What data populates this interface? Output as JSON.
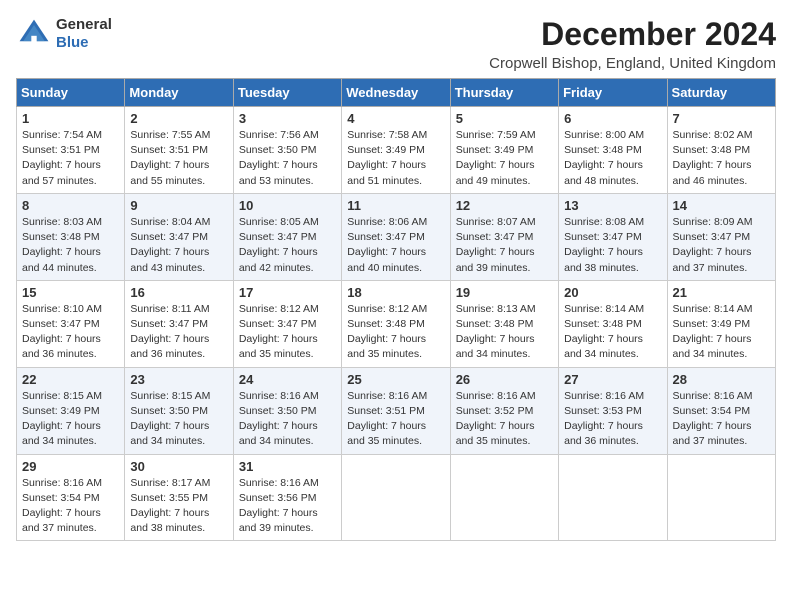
{
  "header": {
    "logo_line1": "General",
    "logo_line2": "Blue",
    "title": "December 2024",
    "subtitle": "Cropwell Bishop, England, United Kingdom"
  },
  "weekdays": [
    "Sunday",
    "Monday",
    "Tuesday",
    "Wednesday",
    "Thursday",
    "Friday",
    "Saturday"
  ],
  "weeks": [
    [
      {
        "day": 1,
        "sunrise": "7:54 AM",
        "sunset": "3:51 PM",
        "daylight": "7 hours and 57 minutes."
      },
      {
        "day": 2,
        "sunrise": "7:55 AM",
        "sunset": "3:51 PM",
        "daylight": "7 hours and 55 minutes."
      },
      {
        "day": 3,
        "sunrise": "7:56 AM",
        "sunset": "3:50 PM",
        "daylight": "7 hours and 53 minutes."
      },
      {
        "day": 4,
        "sunrise": "7:58 AM",
        "sunset": "3:49 PM",
        "daylight": "7 hours and 51 minutes."
      },
      {
        "day": 5,
        "sunrise": "7:59 AM",
        "sunset": "3:49 PM",
        "daylight": "7 hours and 49 minutes."
      },
      {
        "day": 6,
        "sunrise": "8:00 AM",
        "sunset": "3:48 PM",
        "daylight": "7 hours and 48 minutes."
      },
      {
        "day": 7,
        "sunrise": "8:02 AM",
        "sunset": "3:48 PM",
        "daylight": "7 hours and 46 minutes."
      }
    ],
    [
      {
        "day": 8,
        "sunrise": "8:03 AM",
        "sunset": "3:48 PM",
        "daylight": "7 hours and 44 minutes."
      },
      {
        "day": 9,
        "sunrise": "8:04 AM",
        "sunset": "3:47 PM",
        "daylight": "7 hours and 43 minutes."
      },
      {
        "day": 10,
        "sunrise": "8:05 AM",
        "sunset": "3:47 PM",
        "daylight": "7 hours and 42 minutes."
      },
      {
        "day": 11,
        "sunrise": "8:06 AM",
        "sunset": "3:47 PM",
        "daylight": "7 hours and 40 minutes."
      },
      {
        "day": 12,
        "sunrise": "8:07 AM",
        "sunset": "3:47 PM",
        "daylight": "7 hours and 39 minutes."
      },
      {
        "day": 13,
        "sunrise": "8:08 AM",
        "sunset": "3:47 PM",
        "daylight": "7 hours and 38 minutes."
      },
      {
        "day": 14,
        "sunrise": "8:09 AM",
        "sunset": "3:47 PM",
        "daylight": "7 hours and 37 minutes."
      }
    ],
    [
      {
        "day": 15,
        "sunrise": "8:10 AM",
        "sunset": "3:47 PM",
        "daylight": "7 hours and 36 minutes."
      },
      {
        "day": 16,
        "sunrise": "8:11 AM",
        "sunset": "3:47 PM",
        "daylight": "7 hours and 36 minutes."
      },
      {
        "day": 17,
        "sunrise": "8:12 AM",
        "sunset": "3:47 PM",
        "daylight": "7 hours and 35 minutes."
      },
      {
        "day": 18,
        "sunrise": "8:12 AM",
        "sunset": "3:48 PM",
        "daylight": "7 hours and 35 minutes."
      },
      {
        "day": 19,
        "sunrise": "8:13 AM",
        "sunset": "3:48 PM",
        "daylight": "7 hours and 34 minutes."
      },
      {
        "day": 20,
        "sunrise": "8:14 AM",
        "sunset": "3:48 PM",
        "daylight": "7 hours and 34 minutes."
      },
      {
        "day": 21,
        "sunrise": "8:14 AM",
        "sunset": "3:49 PM",
        "daylight": "7 hours and 34 minutes."
      }
    ],
    [
      {
        "day": 22,
        "sunrise": "8:15 AM",
        "sunset": "3:49 PM",
        "daylight": "7 hours and 34 minutes."
      },
      {
        "day": 23,
        "sunrise": "8:15 AM",
        "sunset": "3:50 PM",
        "daylight": "7 hours and 34 minutes."
      },
      {
        "day": 24,
        "sunrise": "8:16 AM",
        "sunset": "3:50 PM",
        "daylight": "7 hours and 34 minutes."
      },
      {
        "day": 25,
        "sunrise": "8:16 AM",
        "sunset": "3:51 PM",
        "daylight": "7 hours and 35 minutes."
      },
      {
        "day": 26,
        "sunrise": "8:16 AM",
        "sunset": "3:52 PM",
        "daylight": "7 hours and 35 minutes."
      },
      {
        "day": 27,
        "sunrise": "8:16 AM",
        "sunset": "3:53 PM",
        "daylight": "7 hours and 36 minutes."
      },
      {
        "day": 28,
        "sunrise": "8:16 AM",
        "sunset": "3:54 PM",
        "daylight": "7 hours and 37 minutes."
      }
    ],
    [
      {
        "day": 29,
        "sunrise": "8:16 AM",
        "sunset": "3:54 PM",
        "daylight": "7 hours and 37 minutes."
      },
      {
        "day": 30,
        "sunrise": "8:17 AM",
        "sunset": "3:55 PM",
        "daylight": "7 hours and 38 minutes."
      },
      {
        "day": 31,
        "sunrise": "8:16 AM",
        "sunset": "3:56 PM",
        "daylight": "7 hours and 39 minutes."
      },
      null,
      null,
      null,
      null
    ]
  ],
  "labels": {
    "sunrise": "Sunrise:",
    "sunset": "Sunset:",
    "daylight": "Daylight:"
  }
}
